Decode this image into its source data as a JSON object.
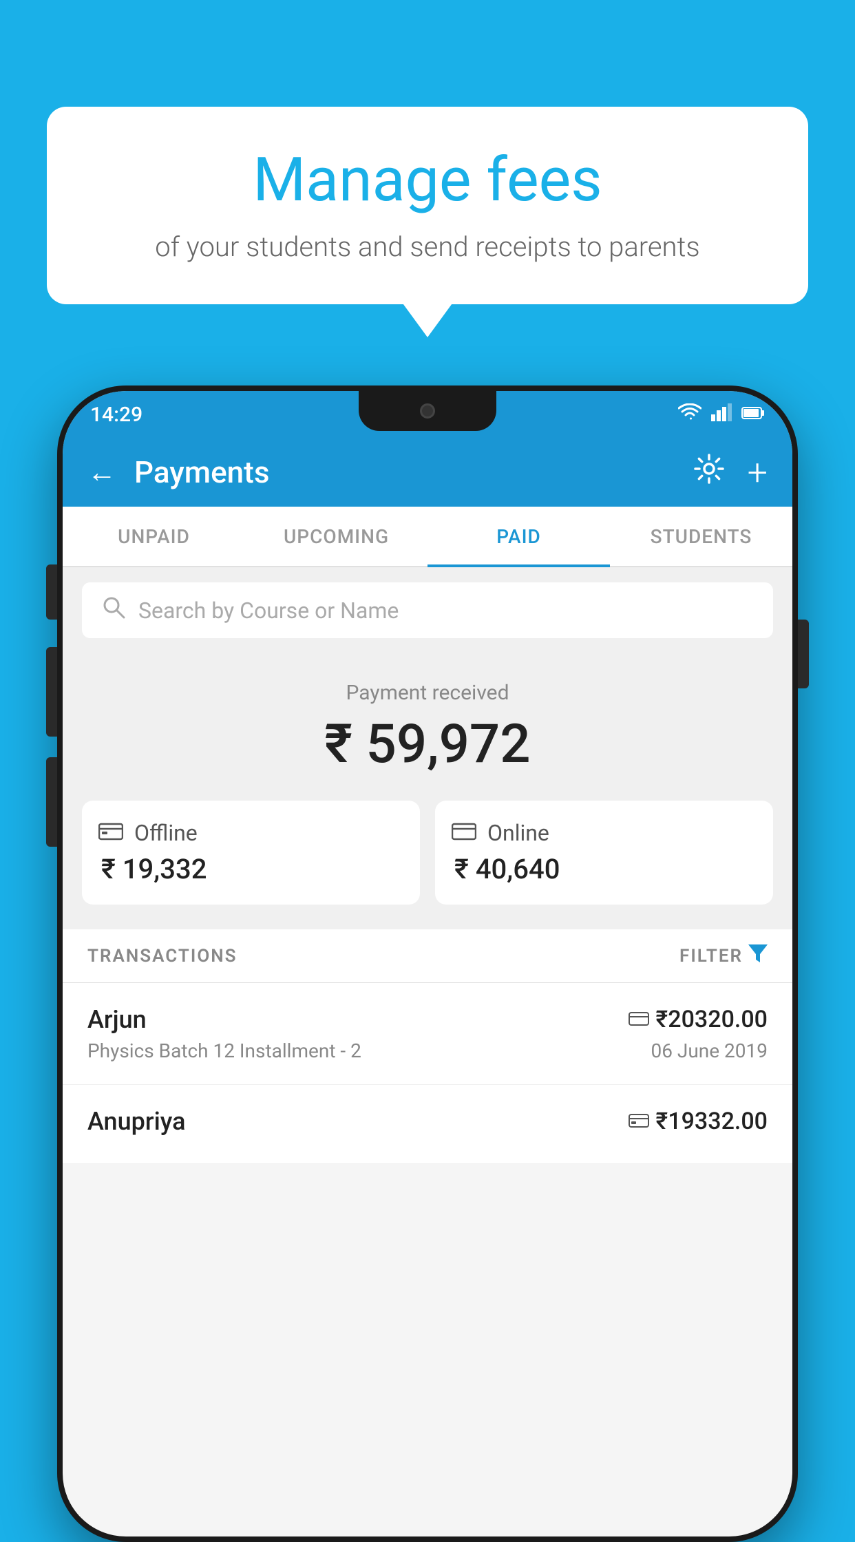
{
  "bubble": {
    "title": "Manage fees",
    "subtitle": "of your students and send receipts to parents"
  },
  "status_bar": {
    "time": "14:29",
    "wifi": "▼",
    "signal": "▲",
    "battery": "▮"
  },
  "header": {
    "title": "Payments",
    "back_label": "←",
    "settings_label": "⚙",
    "add_label": "+"
  },
  "tabs": [
    {
      "label": "UNPAID",
      "active": false
    },
    {
      "label": "UPCOMING",
      "active": false
    },
    {
      "label": "PAID",
      "active": true
    },
    {
      "label": "STUDENTS",
      "active": false
    }
  ],
  "search": {
    "placeholder": "Search by Course or Name"
  },
  "payment_summary": {
    "label": "Payment received",
    "amount": "₹ 59,972"
  },
  "payment_cards": [
    {
      "icon": "offline",
      "label": "Offline",
      "amount": "₹ 19,332"
    },
    {
      "icon": "online",
      "label": "Online",
      "amount": "₹ 40,640"
    }
  ],
  "transactions_header": {
    "label": "TRANSACTIONS",
    "filter_label": "FILTER"
  },
  "transactions": [
    {
      "name": "Arjun",
      "amount": "₹20320.00",
      "description": "Physics Batch 12 Installment - 2",
      "date": "06 June 2019",
      "icon": "online"
    },
    {
      "name": "Anupriya",
      "amount": "₹19332.00",
      "description": "",
      "date": "",
      "icon": "offline"
    }
  ]
}
